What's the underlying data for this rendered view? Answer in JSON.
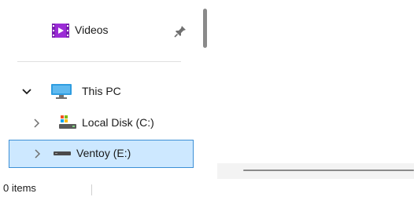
{
  "navigation": {
    "items": [
      {
        "label": "Videos",
        "icon": "videos-folder-icon",
        "pinned": true
      },
      {
        "label": "This PC",
        "icon": "monitor-icon",
        "expanded": true
      },
      {
        "label": "Local Disk (C:)",
        "icon": "drive-icon",
        "expanded": false
      },
      {
        "label": "Ventoy (E:)",
        "icon": "removable-drive-icon",
        "expanded": false,
        "selected": true
      }
    ]
  },
  "status_bar": {
    "item_count": "0 items"
  },
  "colors": {
    "selection_background": "#cde8ff",
    "selection_border": "#3c8fd6",
    "videos_icon": "#9b2bd6",
    "monitor_icon": "#2f9de0"
  }
}
